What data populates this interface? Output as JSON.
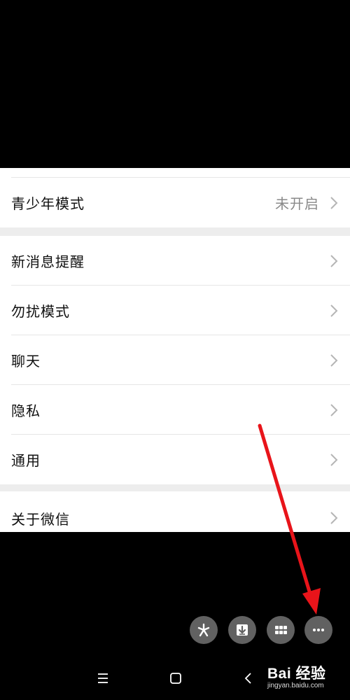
{
  "settings": {
    "youth_mode": {
      "label": "青少年模式",
      "value": "未开启"
    },
    "notifications": {
      "label": "新消息提醒"
    },
    "do_not_disturb": {
      "label": "勿扰模式"
    },
    "chat": {
      "label": "聊天"
    },
    "privacy": {
      "label": "隐私"
    },
    "general": {
      "label": "通用"
    },
    "about": {
      "label": "关于微信"
    }
  },
  "floating_toolbar": {
    "buttons": [
      "asterisk-icon",
      "download-icon",
      "grid-icon",
      "more-icon"
    ]
  },
  "nav_bar": {
    "buttons": [
      "menu-icon",
      "home-icon",
      "back-icon"
    ]
  },
  "watermark": {
    "brand": "Bai 经验",
    "site": "jingyan.baidu.com"
  },
  "annotation": {
    "arrow_color": "#e8141a"
  }
}
